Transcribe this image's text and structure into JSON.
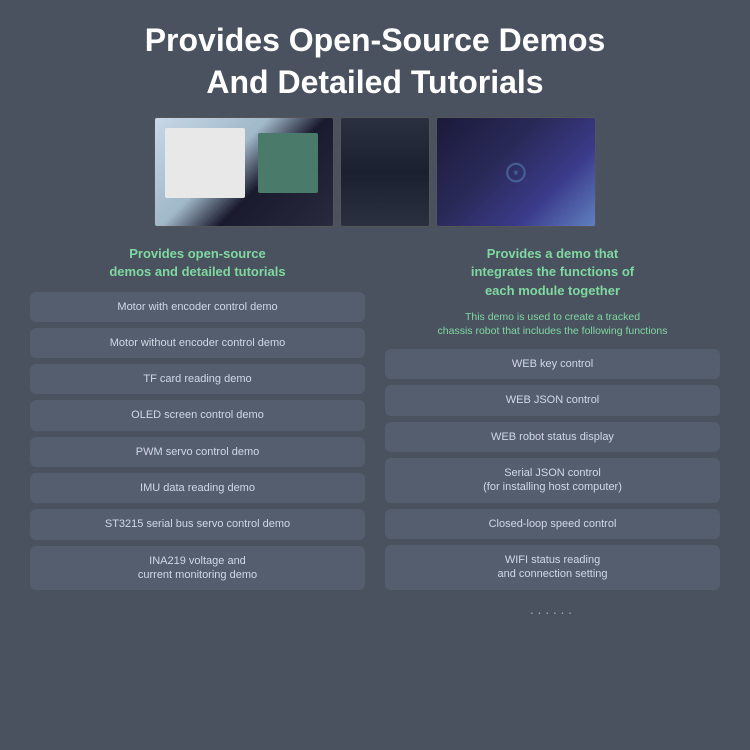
{
  "header": {
    "title_line1": "Provides Open-Source Demos",
    "title_line2": "And Detailed Tutorials"
  },
  "col_left": {
    "heading": "Provides open-source\ndemos and detailed tutorials",
    "items": [
      "Motor with encoder control demo",
      "Motor without encoder control demo",
      "TF card reading demo",
      "OLED screen control demo",
      "PWM servo control demo",
      "IMU data reading demo",
      "ST3215 serial bus servo control demo",
      "INA219 voltage and\ncurrent monitoring demo"
    ]
  },
  "col_right": {
    "heading": "Provides a demo that\nintegrates the functions of\neach module together",
    "sub": "This demo is used to create a tracked\nchassis robot that includes the following functions",
    "items": [
      "WEB key control",
      "WEB JSON control",
      "WEB robot status display",
      "Serial JSON control\n(for installing host computer)",
      "Closed-loop speed control",
      "WIFI status reading\nand connection setting",
      "······"
    ]
  }
}
